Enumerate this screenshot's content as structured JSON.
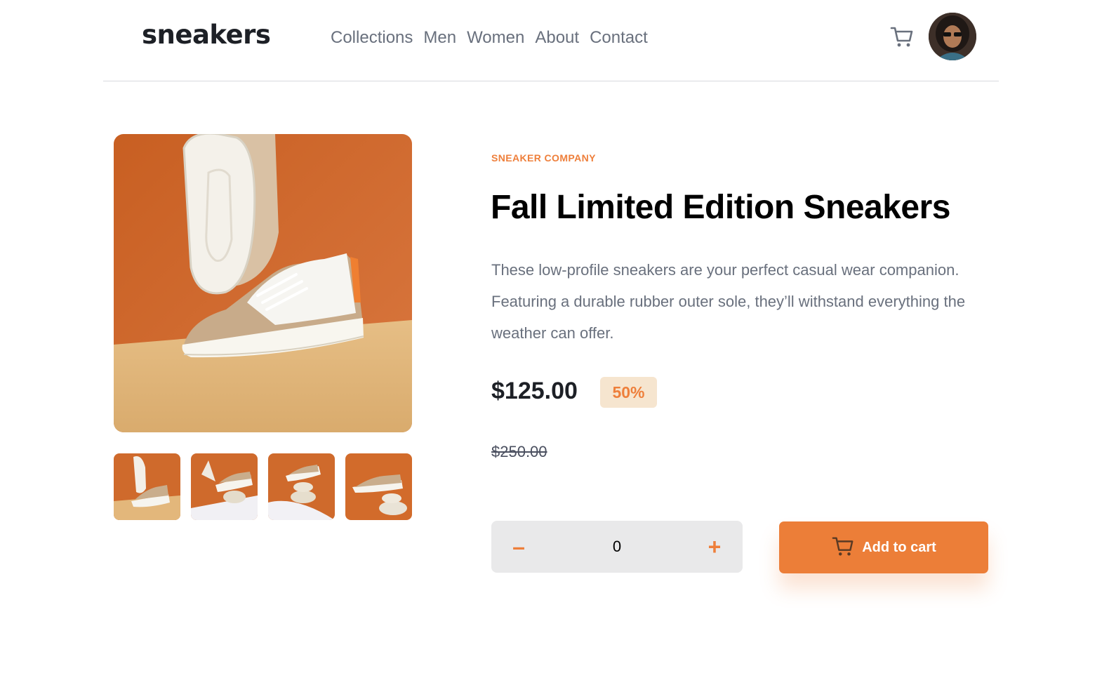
{
  "brand": {
    "logo_text": "sneakers",
    "accent_color": "#ee7f3b"
  },
  "nav": {
    "items": [
      "Collections",
      "Men",
      "Women",
      "About",
      "Contact"
    ]
  },
  "header": {
    "cart_icon": "cart-icon",
    "avatar": "user-avatar"
  },
  "product": {
    "company": "SNEAKER COMPANY",
    "title": "Fall Limited Edition Sneakers",
    "description": "These low-profile sneakers are your perfect casual wear companion. Featuring a durable rubber outer sole, they’ll withstand everything the weather can offer.",
    "price": "$125.00",
    "discount": "50%",
    "original_price": "$250.00"
  },
  "gallery": {
    "thumbnail_count": 4,
    "selected_thumbnail": 1
  },
  "cart_controls": {
    "minus": "–",
    "plus": "+",
    "quantity": "0",
    "add_label": "Add to cart"
  }
}
